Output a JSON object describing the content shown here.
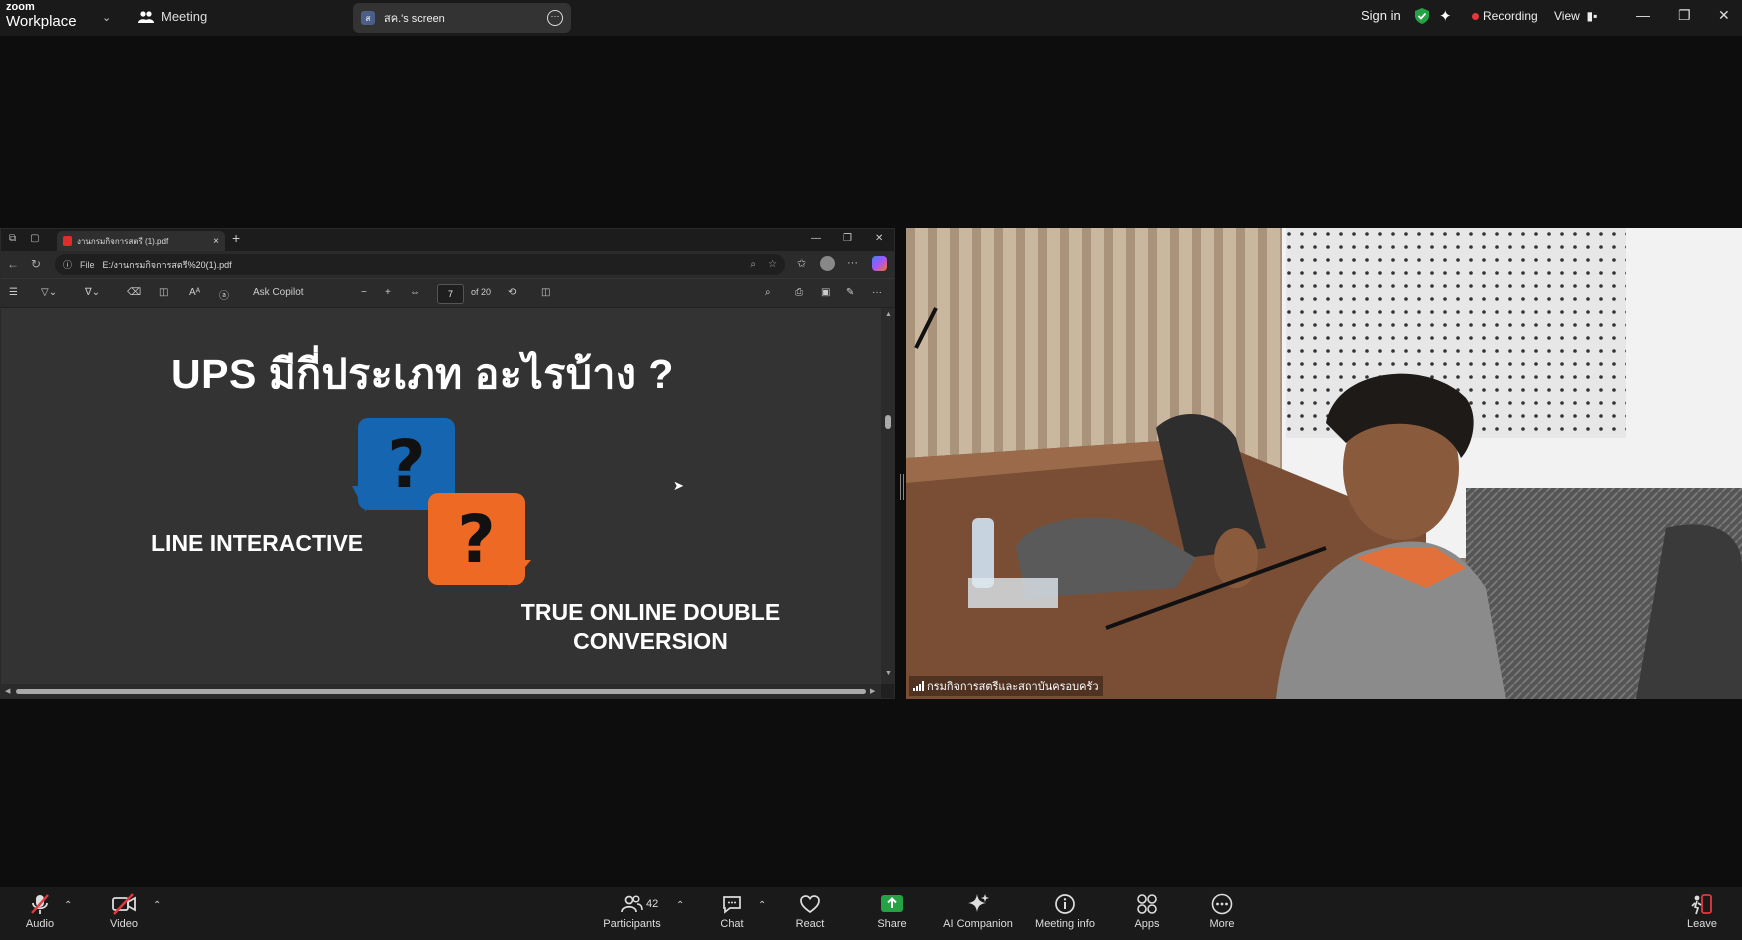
{
  "zoom_top": {
    "logo_line1": "zoom",
    "logo_line2": "Workplace",
    "meeting_label": "Meeting",
    "screen_share_label": "สค.'s screen",
    "screen_avatar": "ส",
    "sign_in": "Sign in",
    "recording": "Recording",
    "view": "View"
  },
  "browser": {
    "tab_title": "งานกรมกิจการสตรี (1).pdf",
    "url_scheme": "File",
    "url": "E:/งานกรมกิจการสตรี%20(1).pdf",
    "ask_copilot": "Ask Copilot",
    "page_current": "7",
    "page_total": "of 20"
  },
  "slide": {
    "title": "UPS มีกี่ประเภท อะไรบ้าง ?",
    "option1": "LINE INTERACTIVE",
    "option2": "TRUE ONLINE DOUBLE CONVERSION",
    "bubble_mark": "?"
  },
  "video": {
    "participant_name": "กรมกิจการสตรีและสถาบันครอบครัว"
  },
  "toolbar": {
    "audio": "Audio",
    "video": "Video",
    "participants": "Participants",
    "participants_count": "42",
    "chat": "Chat",
    "react": "React",
    "share": "Share",
    "ai_companion": "AI Companion",
    "meeting_info": "Meeting info",
    "apps": "Apps",
    "more": "More",
    "leave": "Leave"
  },
  "colors": {
    "share_green": "#25a244",
    "leave_red": "#e5373d",
    "bubble_blue": "#1565b0",
    "bubble_orange": "#ee6a24"
  }
}
